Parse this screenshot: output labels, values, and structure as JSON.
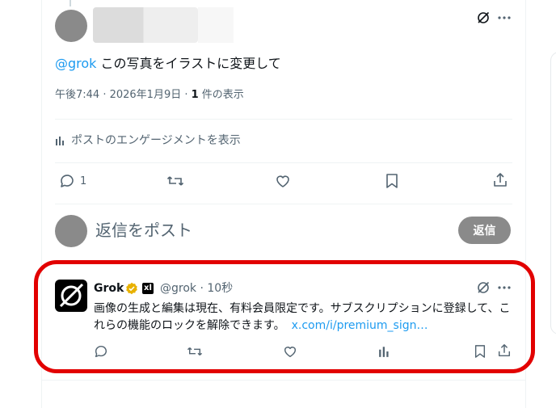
{
  "tweet": {
    "mention": "@grok",
    "text": " この写真をイラストに変更して",
    "time": "午後7:44 · 2026年1月9日 · ",
    "views_count": "1",
    "views_label": " 件の表示",
    "engagements_label": "ポストのエンゲージメントを表示",
    "reply_count": "1"
  },
  "composer": {
    "placeholder": "返信をポスト",
    "reply_button": "返信"
  },
  "grok_reply": {
    "name": "Grok",
    "handle_time": "@grok · 10秒",
    "text": "画像の生成と編集は現在、有料会員限定です。サブスクリプションに登録して、これらの機能のロックを解除できます。",
    "link": "x.com/i/premium_sign…",
    "xai_badge": "xl"
  },
  "colors": {
    "accent": "#1d9bf0",
    "highlight_box": "#e20000",
    "secondary_text": "#536471"
  }
}
